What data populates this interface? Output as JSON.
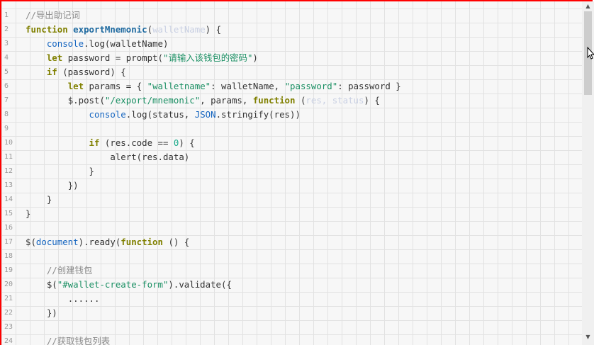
{
  "editor": {
    "line_numbers": [
      "1",
      "2",
      "3",
      "4",
      "5",
      "6",
      "7",
      "8",
      "9",
      "10",
      "11",
      "12",
      "13",
      "14",
      "15",
      "16",
      "17",
      "18",
      "19",
      "20",
      "21",
      "22",
      "23",
      "24"
    ],
    "tokens": {
      "l1_comment": "//导出助记词",
      "l2_function": "function",
      "l2_name": "exportMnemonic",
      "l2_open": "(",
      "l2_param": "walletName",
      "l2_close": ") {",
      "l3_console": "console",
      "l3_rest": ".log(walletName)",
      "l4_let": "let",
      "l4_mid": " password = prompt(",
      "l4_str": "\"请输入该钱包的密码\"",
      "l4_end": ")",
      "l5_if": "if",
      "l5_rest": " (password) {",
      "l6_let": "let",
      "l6_a": " params = { ",
      "l6_s1": "\"walletname\"",
      "l6_b": ": walletName, ",
      "l6_s2": "\"password\"",
      "l6_c": ": password }",
      "l7_a": "$.post(",
      "l7_s": "\"/export/mnemonic\"",
      "l7_b": ", params, ",
      "l7_function": "function",
      "l7_c": " (",
      "l7_params": "res, status",
      "l7_d": ") {",
      "l8_console": "console",
      "l8_a": ".log(status, ",
      "l8_json": "JSON",
      "l8_b": ".stringify(res))",
      "l10_if": "if",
      "l10_a": " (res.code == ",
      "l10_num": "0",
      "l10_b": ") {",
      "l11": "alert(res.data)",
      "l12": "}",
      "l13": "})",
      "l14": "}",
      "l15": "}",
      "l17_a": "$(",
      "l17_doc": "document",
      "l17_b": ").ready(",
      "l17_function": "function",
      "l17_c": " () {",
      "l19_comment": "//创建钱包",
      "l20_a": "$(",
      "l20_s": "\"#wallet-create-form\"",
      "l20_b": ").validate({",
      "l21": "......",
      "l22": "})",
      "l24_comment": "//获取钱包列表"
    }
  },
  "scrollbar": {
    "up_arrow": "▲",
    "down_arrow": "▼",
    "position_fraction": 0.0
  }
}
